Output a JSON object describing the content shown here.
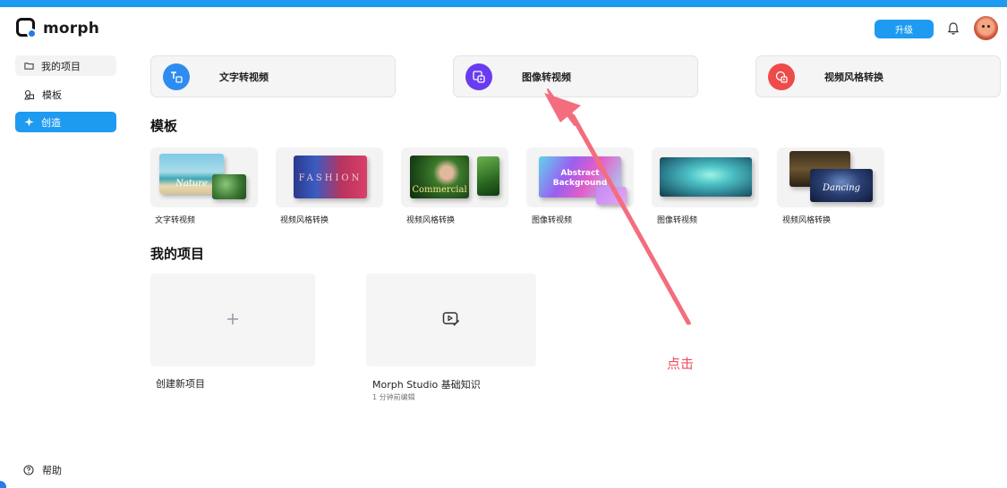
{
  "app": {
    "logo_text": "morph"
  },
  "header": {
    "upgrade_label": "升级"
  },
  "sidebar": {
    "items": [
      {
        "label": "我的项目"
      },
      {
        "label": "模板"
      },
      {
        "label": "创造"
      }
    ],
    "help_label": "帮助"
  },
  "features": [
    {
      "label": "文字转视频",
      "color": "#2d8cf0"
    },
    {
      "label": "图像转视频",
      "color": "#6a3cf0"
    },
    {
      "label": "视频风格转换",
      "color": "#ef4a4a"
    }
  ],
  "templates_section": {
    "title": "模板",
    "items": [
      {
        "label": "文字转视频",
        "image_text": "Nature"
      },
      {
        "label": "视频风格转换",
        "image_text": "FASHION"
      },
      {
        "label": "视频风格转换",
        "image_text": "Commercial"
      },
      {
        "label": "图像转视频",
        "image_text": "Abstract Background"
      },
      {
        "label": "图像转视频",
        "image_text": ""
      },
      {
        "label": "视频风格转换",
        "image_text": "Dancing"
      }
    ]
  },
  "projects_section": {
    "title": "我的项目",
    "new_project_label": "创建新项目",
    "items": [
      {
        "title": "Morph Studio 基础知识",
        "subtitle": "1 分钟前编辑"
      }
    ]
  },
  "annotation": {
    "text": "点击",
    "color": "#f04a5e"
  }
}
